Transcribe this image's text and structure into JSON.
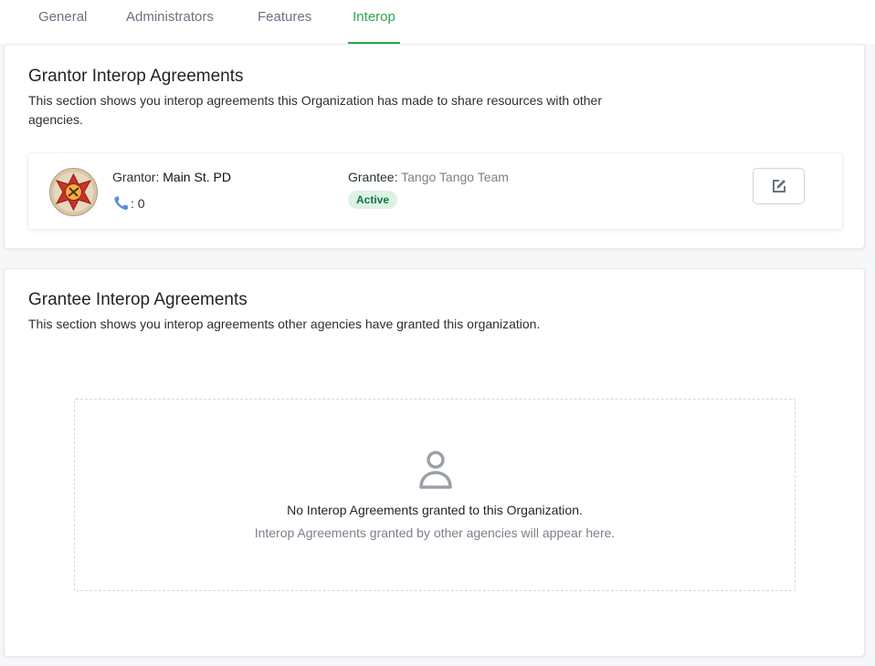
{
  "tabs": [
    {
      "label": "General",
      "active": false
    },
    {
      "label": "Administrators",
      "active": false
    },
    {
      "label": "Features",
      "active": false
    },
    {
      "label": "Interop",
      "active": true
    }
  ],
  "colors": {
    "accent": "#2ea44f",
    "status_active_bg": "#dcf3e4",
    "status_active_text": "#177245"
  },
  "grantor_section": {
    "title": "Grantor Interop Agreements",
    "description": "This section shows you interop agreements this Organization has made to share resources with other agencies.",
    "agreements": [
      {
        "logo_icon": "fire-department-badge-icon",
        "grantor_label": "Grantor:",
        "grantor_value": "Main St. PD",
        "phone_icon": "phone-icon",
        "phone_count": ": 0",
        "grantee_label": "Grantee:",
        "grantee_value": "Tango Tango Team",
        "status": "Active",
        "edit_icon": "edit-icon"
      }
    ]
  },
  "grantee_section": {
    "title": "Grantee Interop Agreements",
    "description": "This section shows you interop agreements other agencies have granted this organization.",
    "empty_state": {
      "icon": "user-icon",
      "title": "No Interop Agreements granted to this Organization.",
      "subtitle": "Interop Agreements granted by other agencies will appear here."
    }
  }
}
